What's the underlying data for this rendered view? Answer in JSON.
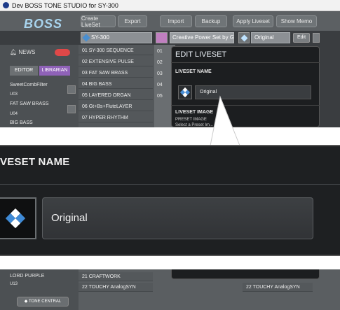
{
  "window": {
    "title": "Dev BOSS TONE STUDIO for SY-300"
  },
  "logo": "BOSS",
  "toolbar": {
    "create_liveset": "Create LiveSet",
    "export": "Export",
    "import": "Import",
    "backup": "Backup",
    "apply_liveset": "Apply Liveset",
    "show_memo": "Show Memo"
  },
  "selectors": {
    "device": "SY-300",
    "liveset_name": "Creative Power Set by Gun...",
    "current_patch": "Original",
    "edit_label": "Edit"
  },
  "sidebar": {
    "news_label": "NEWS",
    "tabs": [
      "EDITOR",
      "LIBRARIAN"
    ],
    "items": [
      "SweetCombFilter",
      "U03",
      "FAT SAW BRASS",
      "U04",
      "BIG BASS"
    ]
  },
  "patch_list": [
    "01  SY-300 SEQUENCE",
    "02  EXTENSIVE PULSE",
    "03  FAT SAW BRASS",
    "04  BIG BASS",
    "05  LAYERED ORGAN",
    "06  Gt+Bs+FluteLAYER",
    "07  HYPER RHYTHM"
  ],
  "col2_numbers": [
    "01",
    "02",
    "03",
    "04",
    "05"
  ],
  "edit_dialog": {
    "title": "EDIT LIVESET",
    "name_label": "LIVESET NAME",
    "name_value": "Original",
    "image_label": "LIVESET IMAGE",
    "preset_label": "PRESET IMAGE",
    "preset_hint": "Select a Preset Im..."
  },
  "zoom": {
    "label": "VESET NAME",
    "value": "Original"
  },
  "bottom": {
    "left_items": [
      "LORD PURPLE",
      "U13"
    ],
    "rows": [
      "21  CRAFTWORK",
      "22  TOUCHY AnalogSYN"
    ],
    "right_row": "22  TOUCHY AnalogSYN",
    "tone_central": "TONE CENTRAL"
  }
}
